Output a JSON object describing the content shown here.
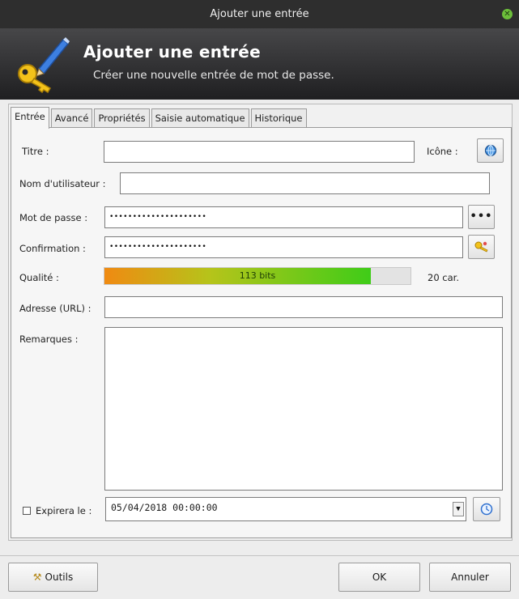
{
  "window": {
    "title": "Ajouter une entrée"
  },
  "banner": {
    "title": "Ajouter une entrée",
    "subtitle": "Créer une nouvelle entrée de mot de passe."
  },
  "tabs": [
    {
      "label": "Entrée"
    },
    {
      "label": "Avancé"
    },
    {
      "label": "Propriétés"
    },
    {
      "label": "Saisie automatique"
    },
    {
      "label": "Historique"
    }
  ],
  "form": {
    "title_label": "Titre :",
    "title_value": "",
    "icon_label": "Icône :",
    "username_label": "Nom d'utilisateur :",
    "username_value": "",
    "password_label": "Mot de passe :",
    "password_value": "•••••••••••••••••••••",
    "confirm_label": "Confirmation :",
    "confirm_value": "•••••••••••••••••••••",
    "quality_label": "Qualité :",
    "quality_text": "113 bits",
    "quality_fraction": 0.87,
    "char_count": "20 car.",
    "url_label": "Adresse (URL) :",
    "url_value": "",
    "notes_label": "Remarques :",
    "notes_value": "",
    "expires_label": "Expirera le :",
    "expires_checked": false,
    "expires_value": "05/04/2018 00:00:00"
  },
  "footer": {
    "tools_label": "Outils",
    "ok_label": "OK",
    "cancel_label": "Annuler"
  },
  "icons": {
    "close": "close-icon",
    "banner": "key-pen-icon",
    "entry_icon": "globe-key-icon",
    "show_password": "dots-icon",
    "generate": "key-generate-icon",
    "calendar": "clock-icon",
    "tools": "wrench-icon"
  },
  "colors": {
    "quality_start": "#f08a12",
    "quality_end": "#3fcc18",
    "titlebar": "#2e2e2e"
  }
}
